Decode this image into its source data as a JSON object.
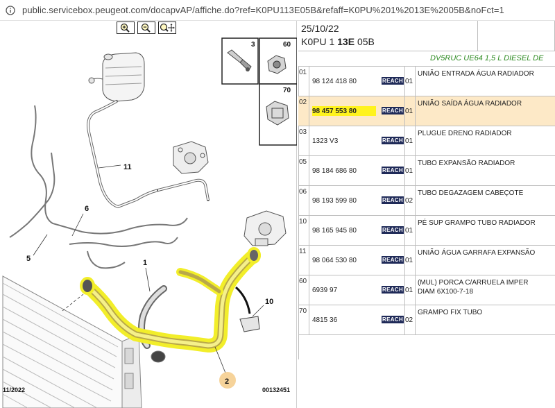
{
  "browser": {
    "url": "public.servicebox.peugeot.com/docapvAP/affiche.do?ref=K0PU113E05B&refaff=K0PU%201%2013E%2005B&noFct=1"
  },
  "toolbar": {
    "zoom_in_icon": "zoom-in-icon",
    "zoom_out_icon": "zoom-out-icon",
    "zoom_pan_icon": "zoom-pan-icon"
  },
  "diagram": {
    "callouts": [
      "1",
      "2",
      "3",
      "5",
      "6",
      "10",
      "11",
      "60",
      "70"
    ],
    "footer_left": "11/2022",
    "footer_right": "00132451",
    "highlight_color": "#f2ee2a"
  },
  "header": {
    "date": "25/10/22",
    "ref_prefix": "K0PU 1 ",
    "ref_bold": "13E",
    "ref_suffix": " 05B",
    "engine": "DV5RUC UE64 1,5 L DIESEL DE"
  },
  "parts": [
    {
      "ref": "01",
      "number": "98 124 418 80",
      "reach": "REACH",
      "qty": "01",
      "desc": [
        "UNIÃO ENTRADA ÁGUA RADIADOR"
      ],
      "selected": false
    },
    {
      "ref": "02",
      "number": "98 457 553 80",
      "reach": "REACH",
      "qty": "01",
      "desc": [
        "UNIÃO SAÍDA ÁGUA RADIADOR"
      ],
      "selected": true
    },
    {
      "ref": "03",
      "number": "1323 V3",
      "reach": "REACH",
      "qty": "01",
      "desc": [
        "PLUGUE DRENO RADIADOR"
      ],
      "selected": false
    },
    {
      "ref": "05",
      "number": "98 184 686 80",
      "reach": "REACH",
      "qty": "01",
      "desc": [
        "TUBO EXPANSÃO RADIADOR"
      ],
      "selected": false
    },
    {
      "ref": "06",
      "number": "98 193 599 80",
      "reach": "REACH",
      "qty": "02",
      "desc": [
        "TUBO DEGAZAGEM CABEÇOTE"
      ],
      "selected": false
    },
    {
      "ref": "10",
      "number": "98 165 945 80",
      "reach": "REACH",
      "qty": "01",
      "desc": [
        "PÉ SUP GRAMPO TUBO RADIADOR"
      ],
      "selected": false
    },
    {
      "ref": "11",
      "number": "98 064 530 80",
      "reach": "REACH",
      "qty": "01",
      "desc": [
        "UNIÃO ÁGUA GARRAFA EXPANSÃO"
      ],
      "selected": false
    },
    {
      "ref": "60",
      "number": "6939 97",
      "reach": "REACH",
      "qty": "01",
      "desc": [
        "(MUL) PORCA C/ARRUELA IMPER",
        "DIAM 6X100-7-18"
      ],
      "selected": false
    },
    {
      "ref": "70",
      "number": "4815 36",
      "reach": "REACH",
      "qty": "02",
      "desc": [
        "GRAMPO FIX TUBO"
      ],
      "selected": false
    }
  ],
  "colors": {
    "selected_row": "#fde9c7",
    "reach_badge": "#1f2a58",
    "engine_text": "#2e8b22"
  }
}
